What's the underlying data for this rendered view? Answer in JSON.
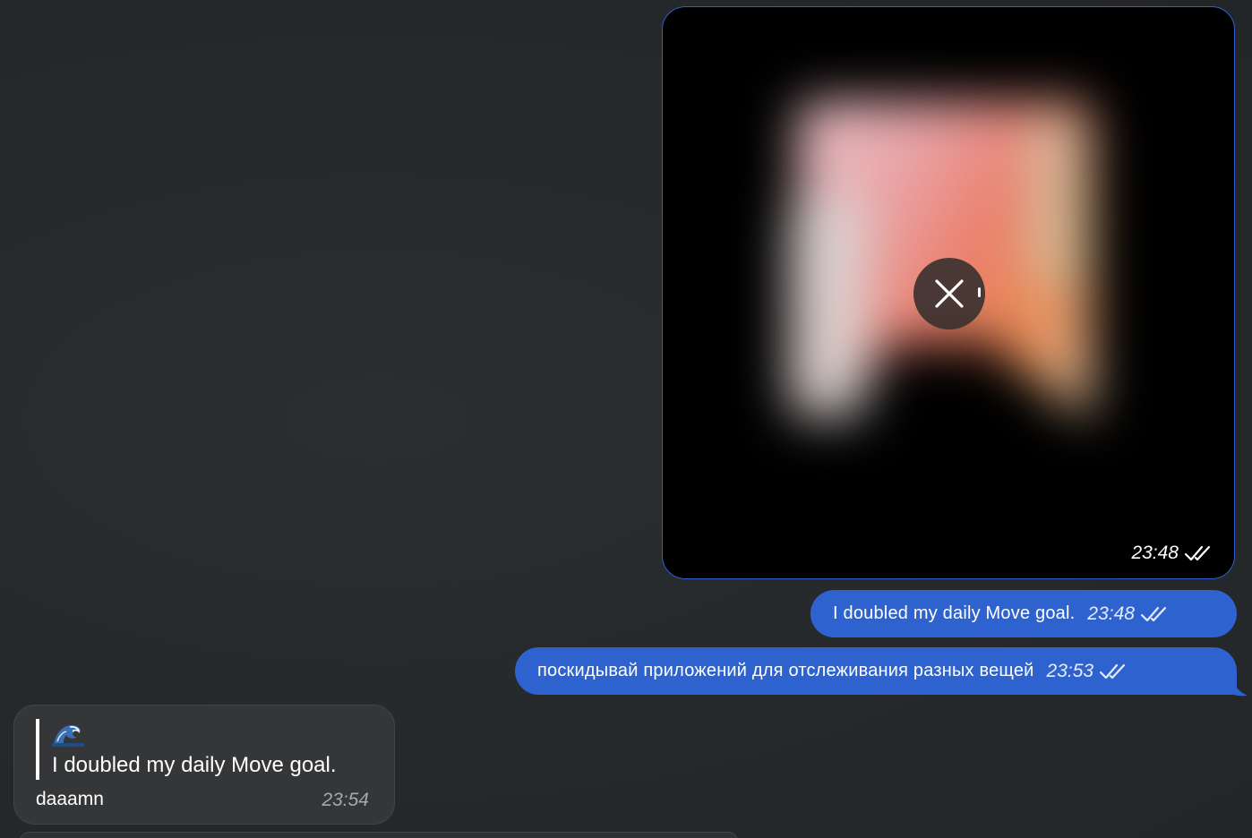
{
  "messages": {
    "photo": {
      "time": "23:48",
      "status_icon": "double-check-icon",
      "overlay_icon": "cancel-upload-icon",
      "upload_progress": 0.02
    },
    "outgoing": [
      {
        "text": "I doubled my daily Move goal.",
        "time": "23:48",
        "status_icon": "double-check-icon"
      },
      {
        "text": "поскидывай приложений для отслеживания разных вещей",
        "time": "23:53",
        "status_icon": "double-check-icon"
      }
    ],
    "incoming": {
      "reply_emoji": "wave-emoji",
      "reply_text": "I doubled my daily Move goal.",
      "text": "daaamn",
      "time": "23:54"
    }
  },
  "colors": {
    "background": "#26292c",
    "outgoing_bubble": "#2e63cf",
    "incoming_bubble": "#343638",
    "time_incoming": "#a6a9ad"
  }
}
